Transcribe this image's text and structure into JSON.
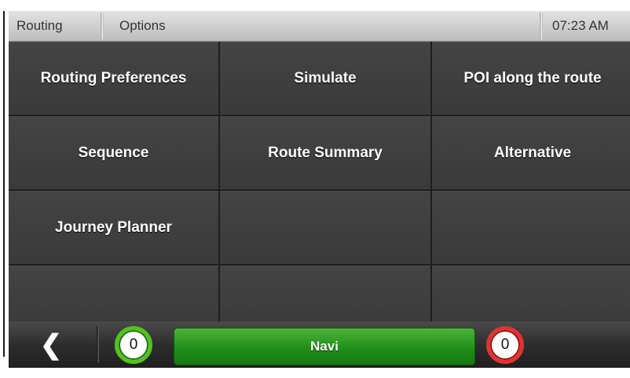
{
  "header": {
    "tab_routing": "Routing",
    "tab_options": "Options",
    "clock": "07:23 AM"
  },
  "menu": {
    "items": [
      "Routing Preferences",
      "Simulate",
      "POI along the route",
      "Sequence",
      "Route Summary",
      "Alternative",
      "Journey Planner",
      "",
      "",
      "",
      "",
      ""
    ]
  },
  "footer": {
    "back_icon": "back-chevron-icon",
    "back_glyph": "❮",
    "left_counter": "0",
    "navi_label": "Navi",
    "right_counter": "0",
    "colors": {
      "navi_green": "#1f8e1a",
      "left_counter_ring": "#52c41a",
      "right_counter_ring": "#e23232"
    }
  }
}
